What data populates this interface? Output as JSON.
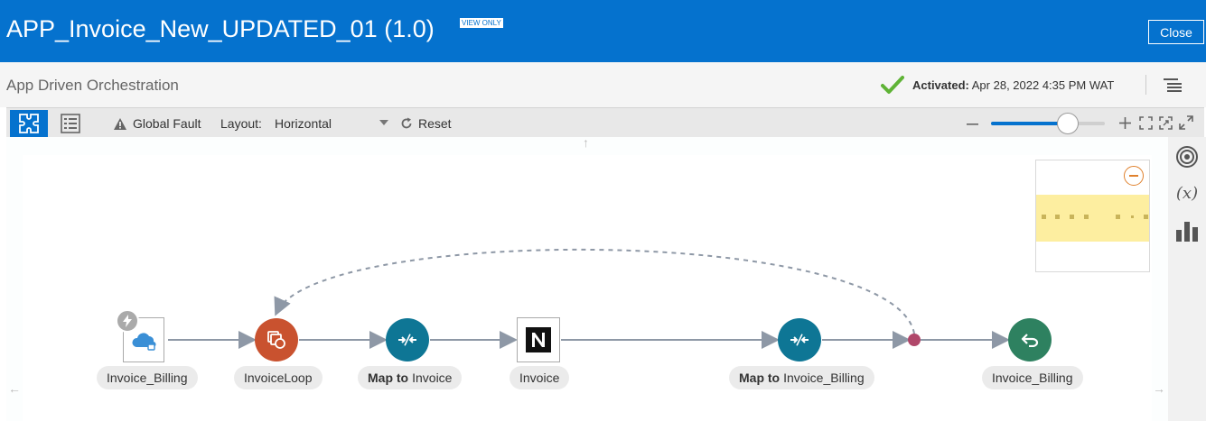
{
  "header": {
    "title": "APP_Invoice_New_UPDATED_01 (1.0)",
    "badge": "VIEW ONLY",
    "close_label": "Close",
    "background_color": "#0572ce"
  },
  "subheader": {
    "title": "App Driven Orchestration",
    "status_label": "Activated:",
    "status_value": "Apr 28, 2022 4:35 PM WAT",
    "status_icon": "check-icon",
    "status_color": "#5fb336"
  },
  "toolbar": {
    "global_fault_label": "Global Fault",
    "layout_label": "Layout:",
    "layout_value": "Horizontal",
    "reset_label": "Reset",
    "zoom_level": 0.7
  },
  "canvas": {
    "nodes": [
      {
        "id": "trigger",
        "label": "Invoice_Billing",
        "kind": "trigger",
        "icon": "cloud-adapter-icon"
      },
      {
        "id": "loop",
        "label": "InvoiceLoop",
        "kind": "for-each",
        "icon": "loop-icon",
        "color": "#c9522f"
      },
      {
        "id": "map1",
        "label_bold": "Map to",
        "label": "Invoice",
        "kind": "map",
        "icon": "map-icon",
        "color": "#0e7695"
      },
      {
        "id": "invoke",
        "label": "Invoice",
        "kind": "invoke",
        "icon": "netsuite-icon"
      },
      {
        "id": "map2",
        "label_bold": "Map to",
        "label": "Invoice_Billing",
        "kind": "map",
        "icon": "map-icon",
        "color": "#0e7695"
      },
      {
        "id": "return",
        "label": "Invoice_Billing",
        "kind": "return",
        "icon": "return-icon",
        "color": "#2e8160"
      }
    ],
    "merge_dot_color": "#b0476a",
    "edge_color": "#8e98a6"
  },
  "right_rail": {
    "icons": [
      "target-icon",
      "variable-icon",
      "bar-chart-icon"
    ],
    "variable_label": "(x)"
  }
}
